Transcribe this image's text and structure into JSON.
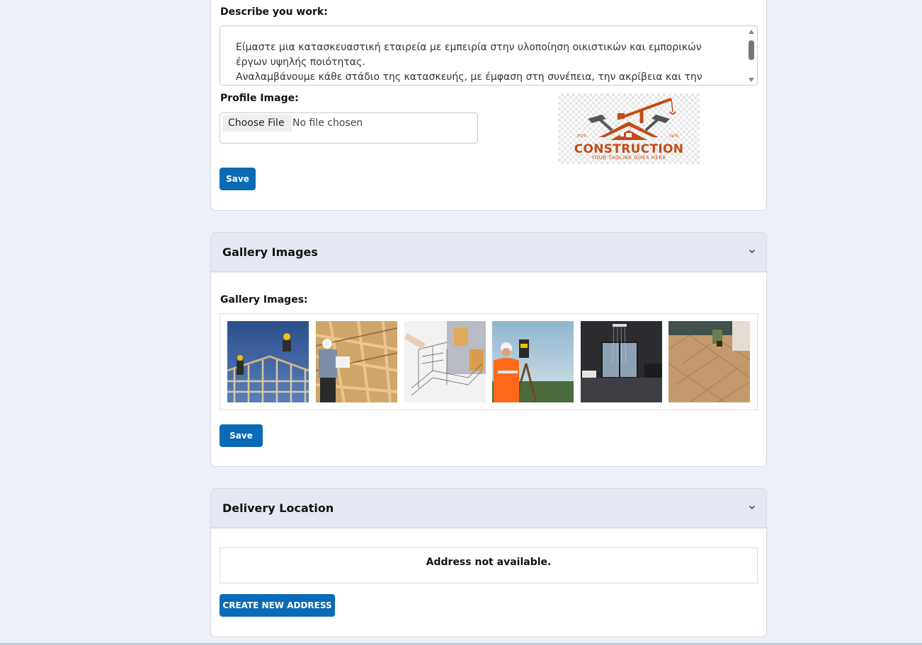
{
  "profile": {
    "describe_label": "Describe you work:",
    "description": "Είμαστε μια κατασκευαστική εταιρεία με εμπειρία στην υλοποίηση οικιστικών και εμπορικών έργων υψηλής ποιότητας.\nΑναλαμβάνουμε κάθε στάδιο της κατασκευής, με έμφαση στη συνέπεια, την ακρίβεια και την τήρηση",
    "image_label": "Profile Image:",
    "choose_file": "Choose File",
    "no_file": "No file chosen",
    "save": "Save",
    "logo_title": "CONSTRUCTION",
    "logo_tagline": "YOUR TAGLINE GOES HERE",
    "logo_estd": "ESTD",
    "logo_year": "1979"
  },
  "gallery": {
    "header": "Gallery Images",
    "label": "Gallery Images:",
    "images": [
      "roof-framers-photo",
      "timber-frame-inspector-photo",
      "architect-sketch-photo",
      "surveyor-photo",
      "modern-bathroom-photo",
      "herringbone-floor-photo"
    ],
    "save": "Save"
  },
  "delivery": {
    "header": "Delivery Location",
    "empty": "Address not available.",
    "create": "CREATE NEW ADDRESS"
  },
  "colors": {
    "primary": "#0a6ab5",
    "page_bg": "#eef0f8",
    "header_bg": "#e6e9f4",
    "logo_orange": "#c44a16"
  }
}
